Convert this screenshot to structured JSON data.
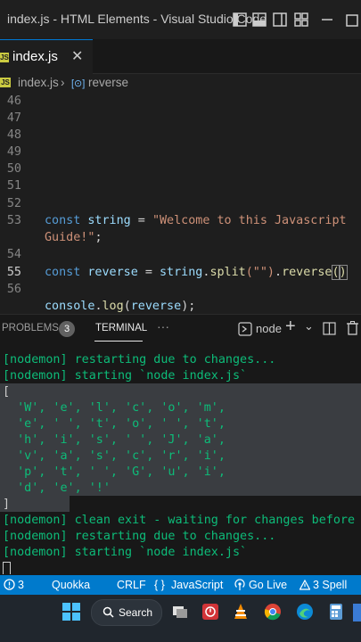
{
  "window": {
    "title": "index.js - HTML Elements - Visual Studio Code"
  },
  "tab": {
    "badge": "JS",
    "label": "index.js",
    "close": "✕"
  },
  "breadcrumb": {
    "badge": "JS",
    "file": "index.js",
    "separator": "›",
    "symbol_icon": "[⊙]",
    "symbol": "reverse"
  },
  "editor": {
    "line_numbers": [
      "46",
      "47",
      "48",
      "49",
      "50",
      "51",
      "52",
      "53",
      "54",
      "55",
      "56"
    ],
    "active_line": "55",
    "code": {
      "l53_kw": "const ",
      "l53_var": "string",
      "l53_op": " = ",
      "l53_str": "\"Welcome to this Javascript",
      "l53_wrap": "Guide!\"",
      "l53_end": ";",
      "l55_kw": "const ",
      "l55_var": "reverse",
      "l55_op": " = ",
      "l55_obj": "string",
      "l55_dot1": ".",
      "l55_fn1": "split",
      "l55_arg": "(\"\")",
      "l55_dot2": ".",
      "l55_fn2": "reverse",
      "l55_paren_open": "(",
      "l55_paren_close": ")",
      "l57_obj": "console",
      "l57_dot": ".",
      "l57_fn": "log",
      "l57_open": "(",
      "l57_arg": "reverse",
      "l57_close": ");"
    }
  },
  "panel": {
    "problems_label": "PROBLEMS",
    "problems_count": "3",
    "terminal_label": "TERMINAL",
    "more": "···",
    "shell": "node",
    "add": "+",
    "dropdown": "⌄"
  },
  "terminal": {
    "lines": [
      "[nodemon] restarting due to changes...",
      "[nodemon] starting `node index.js`",
      "[",
      "  'W', 'e', 'l', 'c', 'o', 'm',",
      "  'e', ' ', 't', 'o', ' ', 't',",
      "  'h', 'i', 's', ' ', 'J', 'a',",
      "  'v', 'a', 's', 'c', 'r', 'i',",
      "  'p', 't', ' ', 'G', 'u', 'i',",
      "  'd', 'e', '!'",
      "]",
      "[nodemon] clean exit - waiting for changes before res",
      "[nodemon] restarting due to changes...",
      "[nodemon] starting `node index.js`"
    ]
  },
  "status": {
    "problems": "3",
    "quokka": "Quokka",
    "eol": "CRLF",
    "language_icon": "{ }",
    "language": "JavaScript",
    "golive": "Go Live",
    "spell": "3 Spell"
  },
  "taskbar": {
    "search_label": "Search"
  },
  "colors": {
    "accent": "#007acc",
    "string": "#ce9178",
    "keyword": "#569cd6",
    "variable": "#9cdcfe",
    "function": "#dcdcaa",
    "terminal_green": "#0dbc79"
  }
}
